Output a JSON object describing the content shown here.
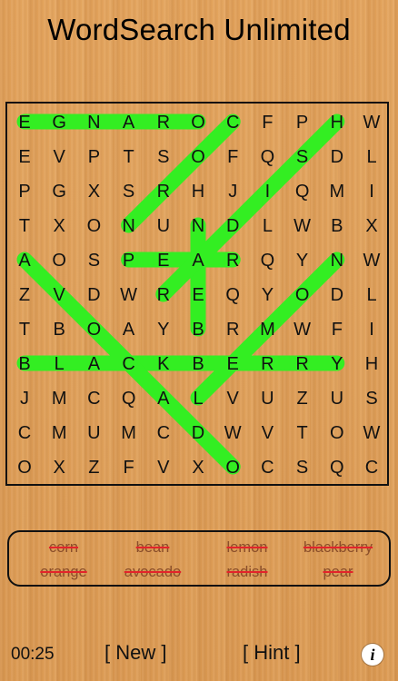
{
  "title": "WordSearch Unlimited",
  "grid": {
    "rows": [
      [
        "E",
        "G",
        "N",
        "A",
        "R",
        "O",
        "C",
        "F",
        "P",
        "H",
        "W"
      ],
      [
        "E",
        "V",
        "P",
        "T",
        "S",
        "O",
        "F",
        "Q",
        "S",
        "D",
        "L"
      ],
      [
        "P",
        "G",
        "X",
        "S",
        "R",
        "H",
        "J",
        "I",
        "Q",
        "M",
        "I"
      ],
      [
        "T",
        "X",
        "O",
        "N",
        "U",
        "N",
        "D",
        "L",
        "W",
        "B",
        "X"
      ],
      [
        "A",
        "O",
        "S",
        "P",
        "E",
        "A",
        "R",
        "Q",
        "Y",
        "N",
        "W"
      ],
      [
        "Z",
        "V",
        "D",
        "W",
        "R",
        "E",
        "Q",
        "Y",
        "O",
        "D",
        "L"
      ],
      [
        "T",
        "B",
        "O",
        "A",
        "Y",
        "B",
        "R",
        "M",
        "W",
        "F",
        "I"
      ],
      [
        "B",
        "L",
        "A",
        "C",
        "K",
        "B",
        "E",
        "R",
        "R",
        "Y",
        "H"
      ],
      [
        "J",
        "M",
        "C",
        "Q",
        "A",
        "L",
        "V",
        "U",
        "Z",
        "U",
        "S"
      ],
      [
        "C",
        "M",
        "U",
        "M",
        "C",
        "D",
        "W",
        "V",
        "T",
        "O",
        "W"
      ],
      [
        "O",
        "X",
        "Z",
        "F",
        "V",
        "X",
        "O",
        "C",
        "S",
        "Q",
        "C"
      ]
    ],
    "highlight_color": "#33ee22",
    "found_paths": [
      {
        "word": "orange",
        "from": [
          0,
          5
        ],
        "to": [
          0,
          0
        ]
      },
      {
        "word": "corn",
        "from": [
          0,
          6
        ],
        "to": [
          3,
          3
        ]
      },
      {
        "word": "lemon",
        "from": [
          8,
          5
        ],
        "to": [
          4,
          9
        ]
      },
      {
        "word": "blackberry",
        "from": [
          7,
          0
        ],
        "to": [
          7,
          9
        ]
      },
      {
        "word": "pear",
        "from": [
          4,
          3
        ],
        "to": [
          4,
          6
        ]
      },
      {
        "word": "bean",
        "from": [
          6,
          5
        ],
        "to": [
          3,
          5
        ]
      },
      {
        "word": "radish",
        "from": [
          5,
          4
        ],
        "to": [
          0,
          9
        ]
      },
      {
        "word": "avocado",
        "from": [
          4,
          0
        ],
        "to": [
          10,
          6
        ]
      }
    ]
  },
  "words": [
    {
      "label": "corn",
      "found": true
    },
    {
      "label": "bean",
      "found": true
    },
    {
      "label": "lemon",
      "found": true
    },
    {
      "label": "blackberry",
      "found": true
    },
    {
      "label": "orange",
      "found": true
    },
    {
      "label": "avocado",
      "found": true
    },
    {
      "label": "radish",
      "found": true
    },
    {
      "label": "pear",
      "found": true
    }
  ],
  "bottom_bar": {
    "timer": "00:25",
    "new_label": "[ New ]",
    "hint_label": "[ Hint ]",
    "info_icon": "info-icon",
    "info_glyph": "i"
  }
}
